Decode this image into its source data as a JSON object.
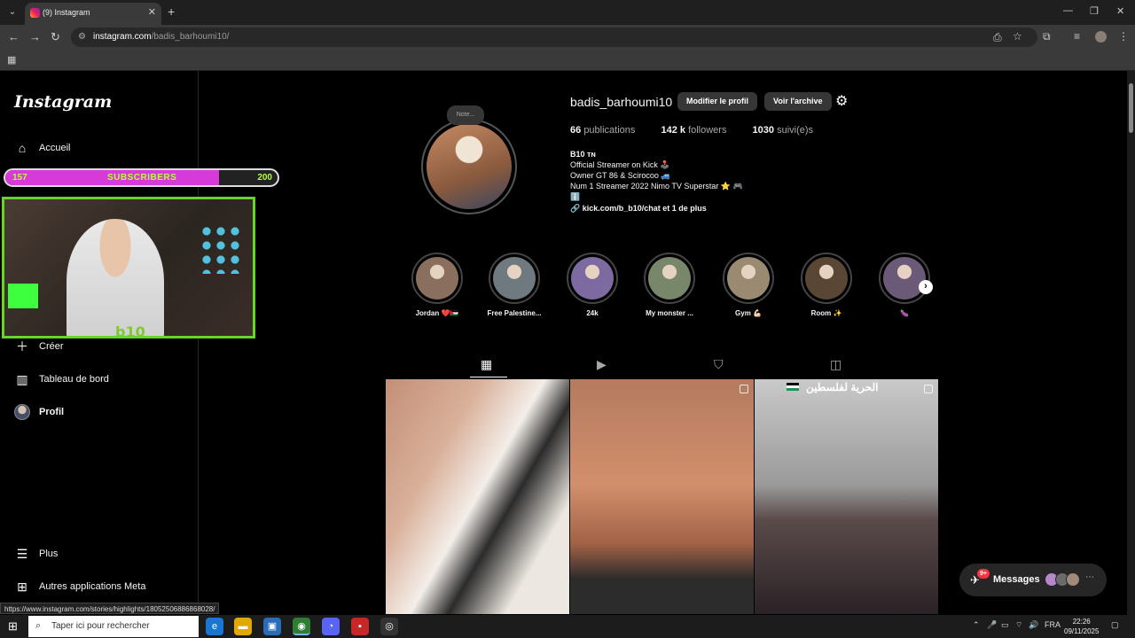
{
  "browser": {
    "tab_title": "(9) Instagram",
    "url_host": "instagram.com",
    "url_path": "/badis_barhoumi10/",
    "status_url": "https://www.instagram.com/stories/highlights/18052506886868028/"
  },
  "sidebar": {
    "logo": "Instagram",
    "items": [
      {
        "label": "Accueil",
        "icon": "home-icon"
      },
      {
        "label": "Créer",
        "icon": "plus-icon"
      },
      {
        "label": "Tableau de bord",
        "icon": "dashboard-icon"
      },
      {
        "label": "Profil",
        "icon": "avatar"
      },
      {
        "label": "Plus",
        "icon": "menu-icon"
      },
      {
        "label": "Autres applications Meta",
        "icon": "meta-apps-icon"
      }
    ]
  },
  "overlay": {
    "sub_current": "157",
    "sub_label": "SUBSCRIBERS",
    "sub_goal": "200",
    "sub_progress": 0.785,
    "cam_tag": "b10"
  },
  "profile": {
    "note": "Note...",
    "username": "badis_barhoumi10",
    "edit_button": "Modifier le profil",
    "archive_button": "Voir l'archive",
    "posts_count": "66",
    "posts_label": "publications",
    "followers_count": "142 k",
    "followers_label": "followers",
    "following_count": "1030",
    "following_label": "suivi(e)s",
    "bio_name": "B10 ᴛɴ",
    "bio_lines": [
      "Official Streamer on Kick 🕹️",
      "Owner GT 86 & Scirocoo 🚙",
      "Num 1 Streamer 2022 Nimo TV Superstar ⭐ 🎮",
      "ℹ️"
    ],
    "link": "kick.com/b_b10/chat et 1 de plus"
  },
  "highlights": [
    {
      "label": "Jordan ❤️🇯🇴",
      "color": "#8a6e5e"
    },
    {
      "label": "Free Palestine...",
      "color": "#6f7a80"
    },
    {
      "label": "24k",
      "color": "#7c6aa0"
    },
    {
      "label": "My monster ...",
      "color": "#78866a"
    },
    {
      "label": "Gym 💪🏻",
      "color": "#9a8a72"
    },
    {
      "label": "Room ✨",
      "color": "#5a4634"
    },
    {
      "label": "🍆",
      "color": "#6a5a78"
    }
  ],
  "post_caption": "الحرية لفلسطين",
  "messages": {
    "label": "Messages",
    "badge": "9+"
  },
  "taskbar": {
    "search_placeholder": "Taper ici pour rechercher",
    "lang": "FRA",
    "time": "22:26",
    "date": "09/11/2025"
  }
}
